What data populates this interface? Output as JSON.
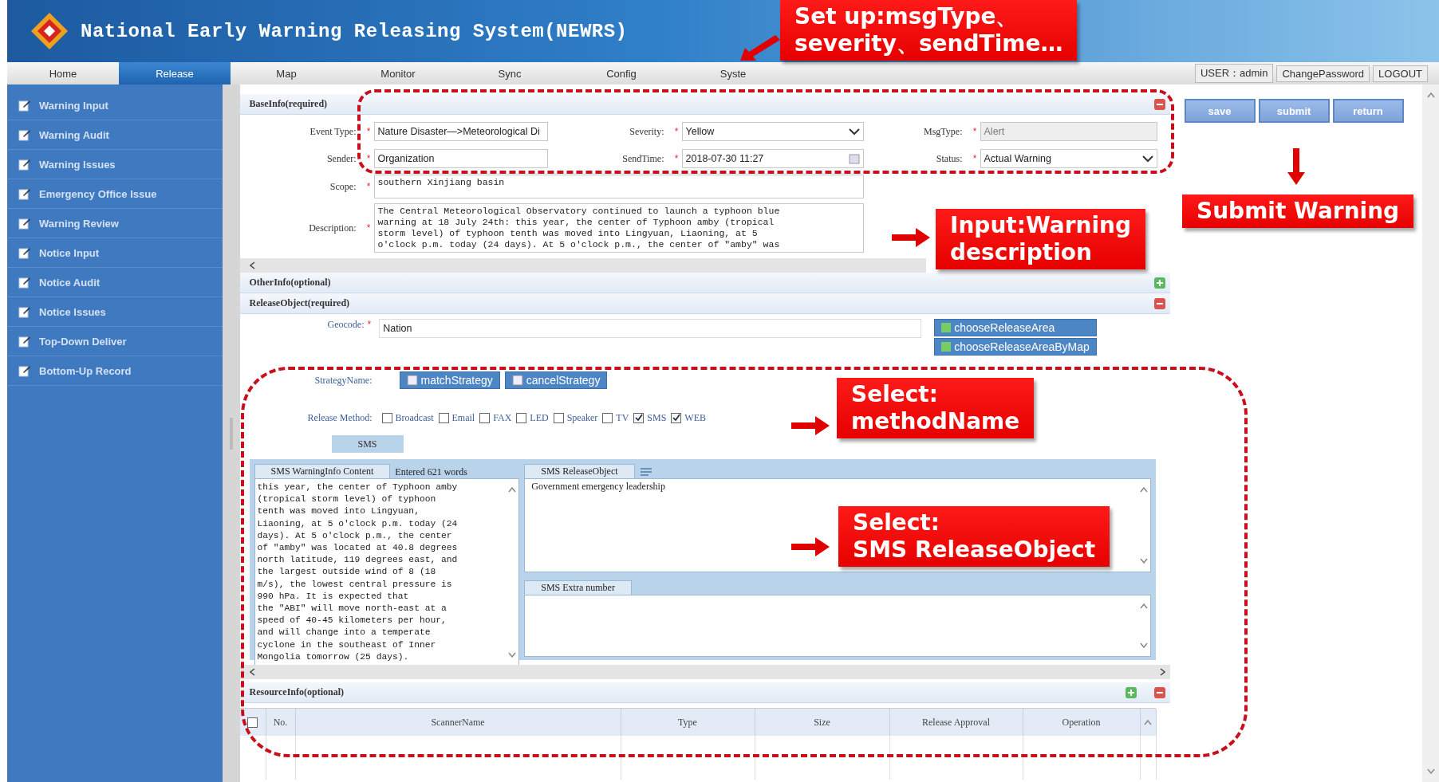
{
  "header": {
    "title": "National Early Warning Releasing System(NEWRS)"
  },
  "nav": {
    "tabs": [
      {
        "label": "Home",
        "selected": false
      },
      {
        "label": "Release",
        "selected": true
      },
      {
        "label": "Map",
        "selected": false
      },
      {
        "label": "Monitor",
        "selected": false
      },
      {
        "label": "Sync",
        "selected": false
      },
      {
        "label": "Config",
        "selected": false
      },
      {
        "label": "Syste",
        "selected": false
      }
    ],
    "user": "USER：admin",
    "change_password": "ChangePassword",
    "logout": "LOGOUT"
  },
  "sidebar": {
    "items": [
      {
        "label": "Warning Input",
        "selected": false
      },
      {
        "label": "Warning Audit",
        "selected": false
      },
      {
        "label": "Warning Issues",
        "selected": false
      },
      {
        "label": "Emergency Office Issue",
        "selected": false
      },
      {
        "label": "Warning Review",
        "selected": false
      },
      {
        "label": "Notice Input",
        "selected": false
      },
      {
        "label": "Notice Audit",
        "selected": false
      },
      {
        "label": "Notice Issues",
        "selected": false
      },
      {
        "label": "Top-Down Deliver",
        "selected": false
      },
      {
        "label": "Bottom-Up Record",
        "selected": false
      }
    ]
  },
  "base_info": {
    "title": "BaseInfo(required)",
    "event_type": {
      "label": "Event Type:",
      "required_mark": "*",
      "value": "Nature Disaster—>Meteorological Di"
    },
    "severity": {
      "label": "Severity:",
      "required_mark": "*",
      "value": "Yellow"
    },
    "msg_type": {
      "label": "MsgType:",
      "required_mark": "*",
      "value": "Alert",
      "disabled": true
    },
    "sender": {
      "label": "Sender:",
      "required_mark": "*",
      "value": "Organization"
    },
    "send_time": {
      "label": "SendTime:",
      "required_mark": "*",
      "value": "2018-07-30 11:27"
    },
    "status": {
      "label": "Status:",
      "required_mark": "*",
      "value": "Actual Warning"
    },
    "scope": {
      "label": "Scope:",
      "required_mark": "*",
      "value": "southern Xinjiang basin"
    },
    "description": {
      "label": "Description:",
      "required_mark": "*",
      "lines": [
        "The Central Meteorological Observatory continued to launch a typhoon blue",
        "warning at 18 July 24th: this year, the center of Typhoon amby (tropical",
        "storm level) of typhoon tenth was moved into Lingyuan, Liaoning, at 5",
        "o'clock p.m. today (24 days). At 5 o'clock p.m., the center of \"amby\" was"
      ]
    }
  },
  "other_info": {
    "title": "OtherInfo(optional)"
  },
  "release_object": {
    "title": "ReleaseObject(required)",
    "geocode": {
      "label": "Geocode:",
      "required_mark": "*",
      "value": "Nation"
    },
    "area_buttons": [
      "chooseReleaseArea",
      "chooseReleaseAreaByMap"
    ],
    "strategy": {
      "label": "StrategyName:",
      "buttons": [
        "matchStrategy",
        "cancelStrategy"
      ]
    },
    "release_method": {
      "label": "Release Method:",
      "options": [
        {
          "label": "Broadcast",
          "checked": false
        },
        {
          "label": "Email",
          "checked": false
        },
        {
          "label": "FAX",
          "checked": false
        },
        {
          "label": "LED",
          "checked": false
        },
        {
          "label": "Speaker",
          "checked": false
        },
        {
          "label": "TV",
          "checked": false
        },
        {
          "label": "SMS",
          "checked": true
        },
        {
          "label": "WEB",
          "checked": true
        }
      ]
    },
    "method_tab": "SMS",
    "content_tab": "SMS  WarningInfo Content",
    "word_count": "Entered 621 words",
    "content_lines": [
      "this year, the center of Typhoon amby",
      "(tropical storm level) of typhoon",
      "tenth was moved into Lingyuan,",
      "Liaoning, at 5 o'clock p.m. today (24",
      "days). At 5 o'clock p.m., the center",
      "of \"amby\" was located at 40.8 degrees",
      "north latitude, 119 degrees east, and",
      "the largest outside wind of 8 (18",
      "m/s), the lowest central pressure is",
      "990 hPa. It is expected that",
      "the \"ABI\" will move north-east at a",
      "speed of 40-45 kilometers per hour,",
      "and will change into a temperate",
      "cyclone in the southeast of Inner",
      "Mongolia tomorrow (25 days)."
    ],
    "object_tab": "SMS ReleaseObject",
    "object_value": "Government emergency leadership",
    "extra_tab": "SMS Extra number"
  },
  "resource_info": {
    "title": "ResourceInfo(optional)",
    "select_all": {
      "checked": false
    },
    "columns": [
      "No.",
      "ScannerName",
      "Type",
      "Size",
      "Release Approval",
      "Operation"
    ]
  },
  "actions": [
    "save",
    "submit",
    "return"
  ],
  "annotations": [
    {
      "lines": [
        "Set up:msgType、",
        "severity、sendTime…"
      ]
    },
    {
      "lines": [
        "Submit Warning"
      ]
    },
    {
      "lines": [
        "Input:Warning",
        "description"
      ]
    },
    {
      "lines": [
        "Select:",
        "methodName"
      ]
    },
    {
      "lines": [
        "Select:",
        "SMS ReleaseObject"
      ]
    }
  ]
}
